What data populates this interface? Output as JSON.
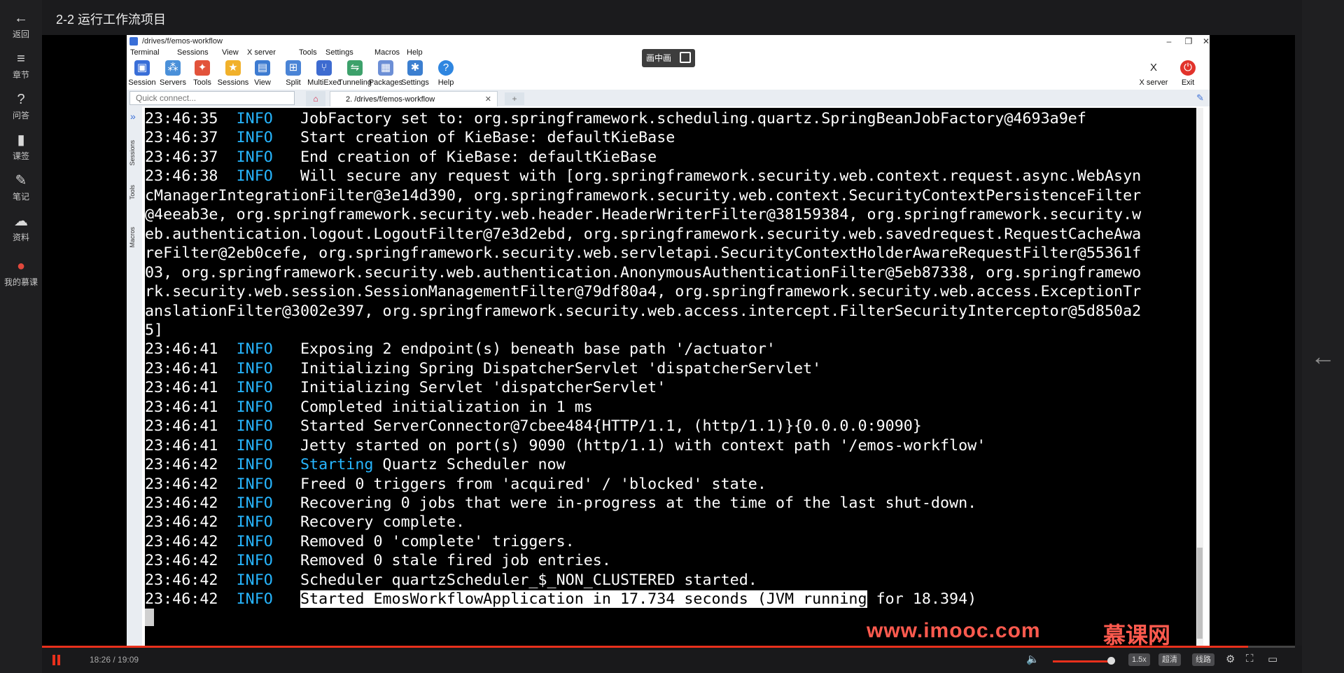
{
  "course": {
    "title": "2-2 运行工作流项目"
  },
  "leftnav": [
    {
      "icon": "←",
      "label": "返回"
    },
    {
      "icon": "≡",
      "label": "章节"
    },
    {
      "icon": "?",
      "label": "问答"
    },
    {
      "icon": "▮",
      "label": "课签"
    },
    {
      "icon": "✎",
      "label": "笔记"
    },
    {
      "icon": "☁",
      "label": "资料"
    },
    {
      "icon": "●",
      "label": "我的慕课"
    }
  ],
  "moba": {
    "window_title": "/drives/f/emos-workflow",
    "menu": [
      "Terminal",
      "Sessions",
      "View",
      "X server",
      "Tools",
      "Settings",
      "Macros",
      "Help"
    ],
    "toolbar": [
      {
        "label": "Session",
        "color": "#3a6fd8"
      },
      {
        "label": "Servers",
        "color": "#4a90d9"
      },
      {
        "label": "Tools",
        "color": "#e2533b"
      },
      {
        "label": "Sessions",
        "color": "#f1b12b"
      },
      {
        "label": "View",
        "color": "#3d7bd1"
      },
      {
        "label": "Split",
        "color": "#4a84d6"
      },
      {
        "label": "MultiExec",
        "color": "#3d6bd0"
      },
      {
        "label": "Tunneling",
        "color": "#3da16b"
      },
      {
        "label": "Packages",
        "color": "#6c8fd6"
      },
      {
        "label": "Settings",
        "color": "#3b7fd0"
      },
      {
        "label": "Help",
        "color": "#2f86e0"
      }
    ],
    "right_toolbar": [
      {
        "label": "X server",
        "color": "#222"
      },
      {
        "label": "Exit",
        "color": "#e2332b"
      }
    ],
    "quick_connect_placeholder": "Quick connect...",
    "session_tab": "2. /drives/f/emos-workflow",
    "sidebar_labels": [
      "Sessions",
      "Tools",
      "Macros"
    ]
  },
  "pip_label": "画中画",
  "terminal_lines": [
    {
      "time": "23:46:35",
      "level": "INFO",
      "msg": "JobFactory set to: org.springframework.scheduling.quartz.SpringBeanJobFactory@4693a9ef"
    },
    {
      "time": "23:46:37",
      "level": "INFO",
      "msg": "Start creation of KieBase: defaultKieBase"
    },
    {
      "time": "23:46:37",
      "level": "INFO",
      "msg": "End creation of KieBase: defaultKieBase"
    },
    {
      "time": "23:46:38",
      "level": "INFO",
      "msg": "Will secure any request with [org.springframework.security.web.context.request.async.WebAsyn"
    },
    {
      "wrap": "cManagerIntegrationFilter@3e14d390, org.springframework.security.web.context.SecurityContextPersistenceFilter"
    },
    {
      "wrap": "@4eeab3e, org.springframework.security.web.header.HeaderWriterFilter@38159384, org.springframework.security.w"
    },
    {
      "wrap": "eb.authentication.logout.LogoutFilter@7e3d2ebd, org.springframework.security.web.savedrequest.RequestCacheAwa"
    },
    {
      "wrap": "reFilter@2eb0cefe, org.springframework.security.web.servletapi.SecurityContextHolderAwareRequestFilter@55361f"
    },
    {
      "wrap": "03, org.springframework.security.web.authentication.AnonymousAuthenticationFilter@5eb87338, org.springframewo"
    },
    {
      "wrap": "rk.security.web.session.SessionManagementFilter@79df80a4, org.springframework.security.web.access.ExceptionTr"
    },
    {
      "wrap": "anslationFilter@3002e397, org.springframework.security.web.access.intercept.FilterSecurityInterceptor@5d850a2"
    },
    {
      "wrap": "5]"
    },
    {
      "time": "23:46:41",
      "level": "INFO",
      "msg": "Exposing 2 endpoint(s) beneath base path '/actuator'"
    },
    {
      "time": "23:46:41",
      "level": "INFO",
      "msg": "Initializing Spring DispatcherServlet 'dispatcherServlet'"
    },
    {
      "time": "23:46:41",
      "level": "INFO",
      "msg": "Initializing Servlet 'dispatcherServlet'"
    },
    {
      "time": "23:46:41",
      "level": "INFO",
      "msg": "Completed initialization in 1 ms"
    },
    {
      "time": "23:46:41",
      "level": "INFO",
      "msg": "Started ServerConnector@7cbee484{HTTP/1.1, (http/1.1)}{0.0.0.0:9090}"
    },
    {
      "time": "23:46:41",
      "level": "INFO",
      "msg": "Jetty started on port(s) 9090 (http/1.1) with context path '/emos-workflow'"
    },
    {
      "time": "23:46:42",
      "level": "INFO",
      "hl": "Starting",
      "msg": " Quartz Scheduler now"
    },
    {
      "time": "23:46:42",
      "level": "INFO",
      "msg": "Freed 0 triggers from 'acquired' / 'blocked' state."
    },
    {
      "time": "23:46:42",
      "level": "INFO",
      "msg": "Recovering 0 jobs that were in-progress at the time of the last shut-down."
    },
    {
      "time": "23:46:42",
      "level": "INFO",
      "msg": "Recovery complete."
    },
    {
      "time": "23:46:42",
      "level": "INFO",
      "msg": "Removed 0 'complete' triggers."
    },
    {
      "time": "23:46:42",
      "level": "INFO",
      "msg": "Removed 0 stale fired job entries."
    },
    {
      "time": "23:46:42",
      "level": "INFO",
      "msg": "Scheduler quartzScheduler_$_NON_CLUSTERED started."
    },
    {
      "time": "23:46:42",
      "level": "INFO",
      "sel": "Started EmosWorkflowApplication in 17.734 seconds (JVM running",
      "msg": " for 18.394)"
    }
  ],
  "watermark": "www.imooc.com",
  "watermark_logo": "慕课网",
  "player": {
    "time": "18:26 / 19:09",
    "progress": 0.9625,
    "speed": "1.5x",
    "quality": "超清",
    "route": "线路",
    "accent": "#e8301c"
  }
}
